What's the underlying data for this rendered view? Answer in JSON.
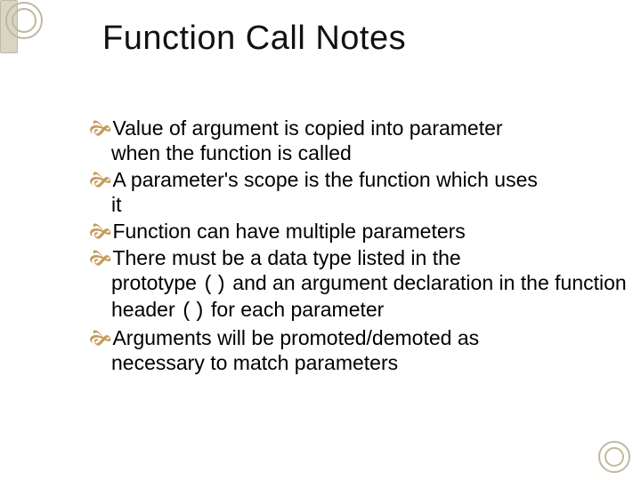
{
  "title": "Function Call Notes",
  "bullets": {
    "b1_first": "Value of argument is copied into parameter",
    "b1_rest": "when the function is called",
    "b2_first": "A parameter's scope is the function which uses",
    "b2_rest": "it",
    "b3": "Function can have multiple parameters",
    "b4_first": "There must be a data type listed in the",
    "b4_rest_a": "prototype ",
    "b4_code1": "()",
    "b4_rest_b": " and an argument declaration in the function header ",
    "b4_code2": "()",
    "b4_rest_c": " for each parameter",
    "b5_first": "Arguments will be promoted/demoted as",
    "b5_rest": "necessary to match parameters"
  }
}
